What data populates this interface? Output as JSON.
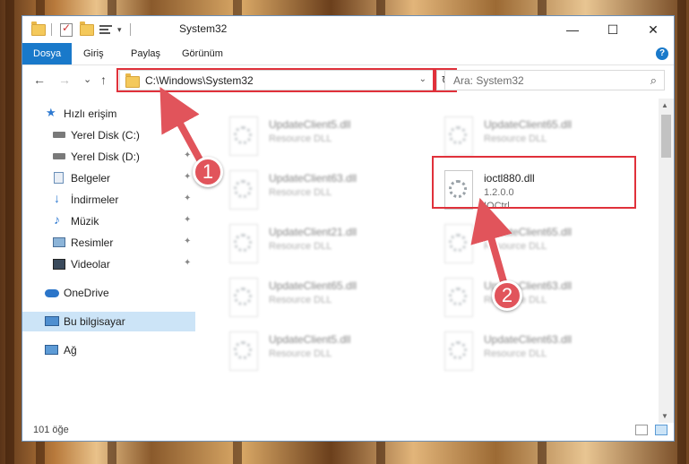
{
  "window": {
    "title": "System32",
    "minimize_glyph": "—",
    "maximize_glyph": "☐",
    "close_glyph": "✕"
  },
  "ribbon": {
    "tabs": [
      {
        "label": "Dosya",
        "active": true
      },
      {
        "label": "Giriş"
      },
      {
        "label": "Paylaş"
      },
      {
        "label": "Görünüm"
      }
    ],
    "help_label": "?"
  },
  "nav": {
    "back_glyph": "←",
    "forward_glyph": "→",
    "recent_glyph": "⌄",
    "up_glyph": "↑",
    "address": "C:\\Windows\\System32",
    "address_dropdown_glyph": "⌄",
    "refresh_glyph": "↻",
    "search_placeholder": "Ara: System32",
    "search_glyph": "⌕"
  },
  "sidebar": {
    "items": [
      {
        "label": "Hızlı erişim",
        "icon": "star-icon",
        "color": "#2f7ad1"
      },
      {
        "label": "Yerel Disk (C:)",
        "icon": "drive-icon",
        "pinned": true
      },
      {
        "label": "Yerel Disk (D:)",
        "icon": "drive-icon",
        "pinned": true
      },
      {
        "label": "Belgeler",
        "icon": "documents-icon",
        "pinned": true
      },
      {
        "label": "İndirmeler",
        "icon": "download-icon",
        "pinned": true
      },
      {
        "label": "Müzik",
        "icon": "music-icon",
        "pinned": true
      },
      {
        "label": "Resimler",
        "icon": "pictures-icon",
        "pinned": true
      },
      {
        "label": "Videolar",
        "icon": "video-icon",
        "pinned": true
      },
      {
        "label": "OneDrive",
        "icon": "cloud-icon"
      },
      {
        "label": "Bu bilgisayar",
        "icon": "computer-icon",
        "selected": true
      },
      {
        "label": "Ağ",
        "icon": "network-icon"
      }
    ],
    "pin_glyph": "📌"
  },
  "files": [
    {
      "name": "UpdateClient5.dll",
      "desc": "Resource DLL",
      "blurred": true
    },
    {
      "name": "UpdateClient65.dll",
      "desc": "Resource DLL",
      "blurred": true
    },
    {
      "name": "UpdateClient63.dll",
      "desc": "Resource DLL",
      "blurred": true
    },
    {
      "name": "ioctl880.dll",
      "version": "1.2.0.0",
      "desc": "IOCtrl",
      "blurred": false
    },
    {
      "name": "UpdateClient21.dll",
      "desc": "Resource DLL",
      "blurred": true
    },
    {
      "name": "UpdateClient65.dll",
      "desc": "Resource DLL",
      "blurred": true
    },
    {
      "name": "UpdateClient65.dll",
      "desc": "Resource DLL",
      "blurred": true
    },
    {
      "name": "UpdateClient63.dll",
      "desc": "Resource DLL",
      "blurred": true
    },
    {
      "name": "UpdateClient5.dll",
      "desc": "Resource DLL",
      "blurred": true
    },
    {
      "name": "UpdateClient63.dll",
      "desc": "Resource DLL",
      "blurred": true
    }
  ],
  "status": {
    "count": "101 öğe"
  },
  "annotations": {
    "step1": "1",
    "step2": "2",
    "color": "#e0313b"
  }
}
